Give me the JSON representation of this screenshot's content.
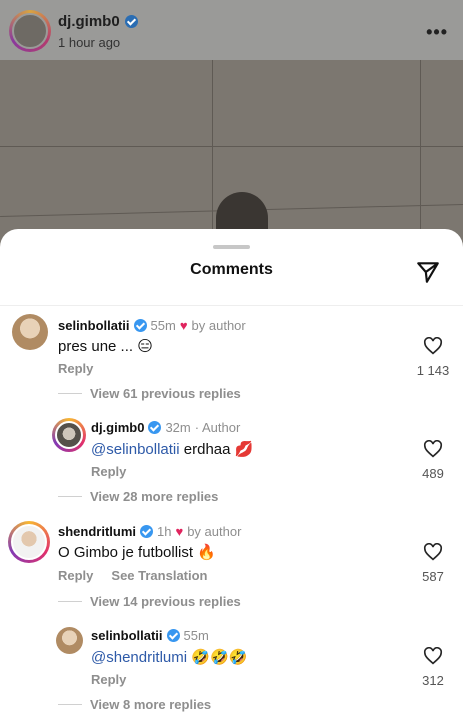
{
  "post": {
    "username": "dj.gimb0",
    "time": "1 hour ago",
    "more_icon": "more-horizontal-icon"
  },
  "sheet": {
    "title": "Comments",
    "send_icon": "send-icon"
  },
  "comments": [
    {
      "username": "selinbollatii",
      "time": "55m",
      "liked_by_author": "by author",
      "text": "pres une ... ",
      "emoji": "😑",
      "reply_label": "Reply",
      "likes": "1 143",
      "view_replies": "View 61 previous replies"
    },
    {
      "username": "dj.gimb0",
      "time": "32m",
      "badge": "· Author",
      "mention": "@selinbollatii",
      "text": " erdhaa ",
      "emoji": "💋",
      "reply_label": "Reply",
      "likes": "489",
      "view_replies": "View 28 more replies"
    },
    {
      "username": "shendritlumi",
      "time": "1h",
      "liked_by_author": "by author",
      "text": "O Gimbo je futbollist ",
      "emoji": "🔥",
      "reply_label": "Reply",
      "translation_label": "See Translation",
      "likes": "587",
      "view_replies": "View 14 previous replies"
    },
    {
      "username": "selinbollatii",
      "time": "55m",
      "mention": "@shendritlumi",
      "text": " ",
      "emoji": "🤣🤣🤣",
      "reply_label": "Reply",
      "likes": "312",
      "view_replies": "View 8 more replies"
    }
  ],
  "colors": {
    "heart_red": "#e0245e",
    "verified_blue": "#3897f0",
    "mention_blue": "#2e5aa8"
  }
}
